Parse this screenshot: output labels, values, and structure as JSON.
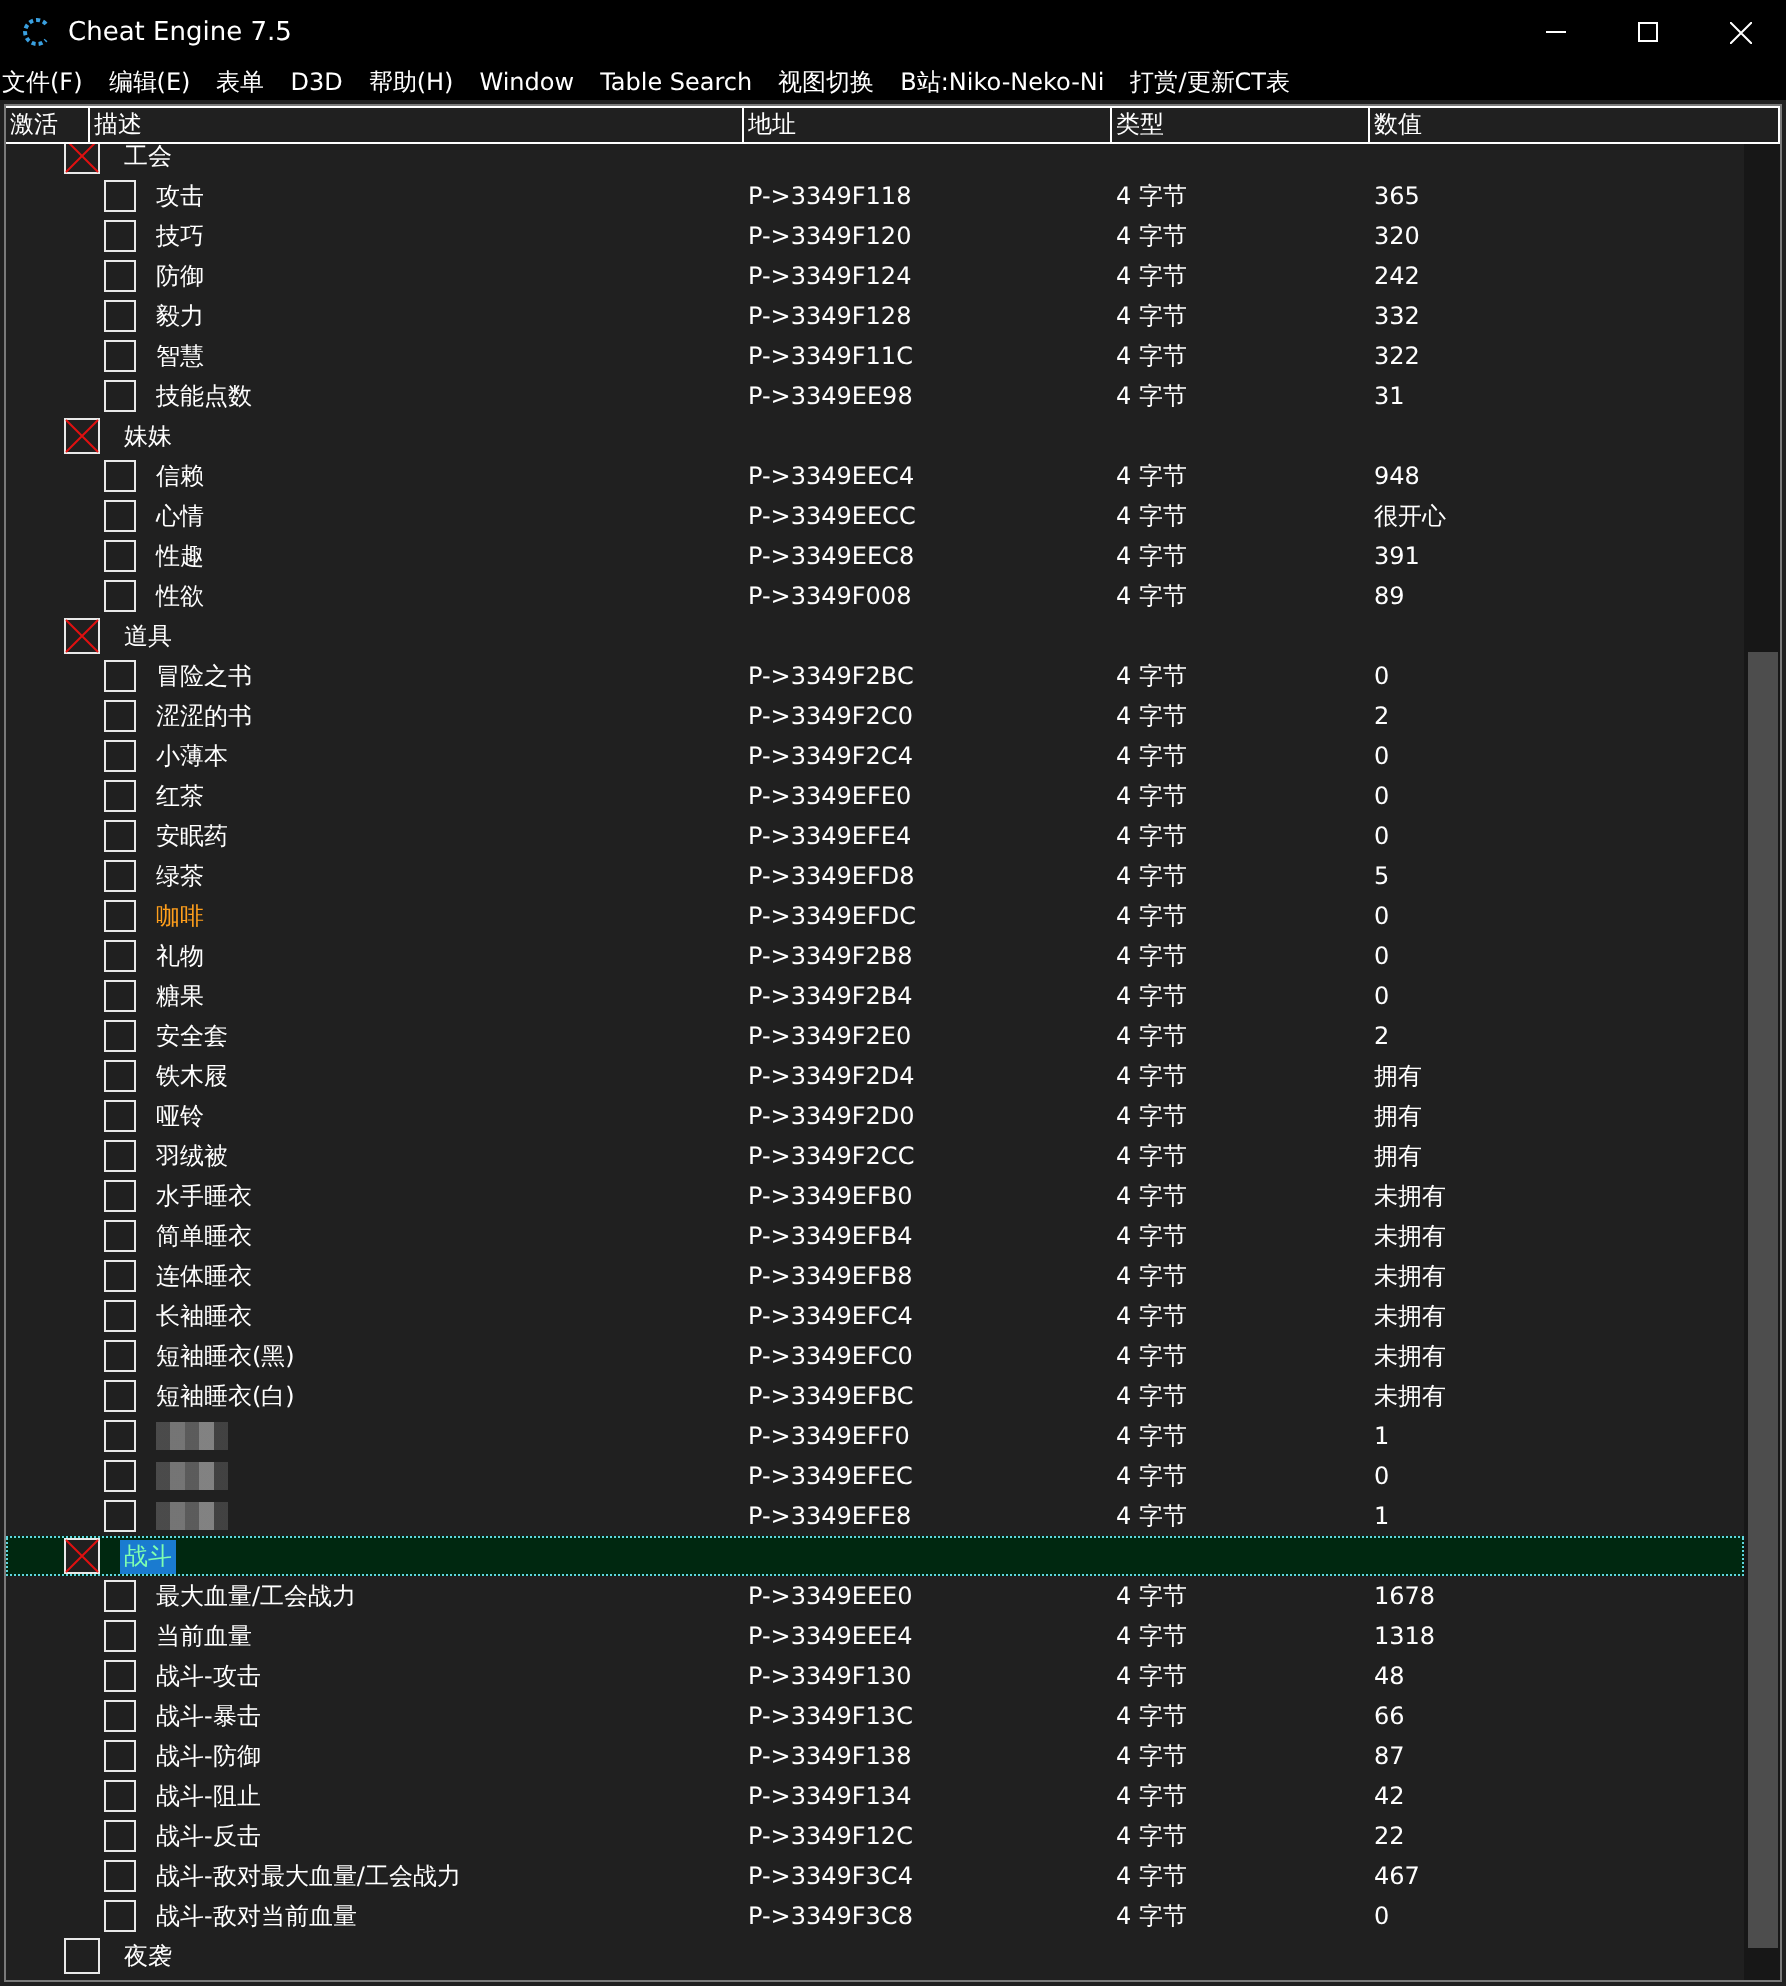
{
  "window": {
    "title": "Cheat Engine 7.5"
  },
  "menu": [
    "文件(F)",
    "编辑(E)",
    "表单",
    "D3D",
    "帮助(H)",
    "Window",
    "Table Search",
    "视图切换",
    "B站:Niko-Neko-Ni",
    "打赏/更新CT表"
  ],
  "table": {
    "columns": [
      "激活",
      "描述",
      "地址",
      "类型",
      "数值"
    ],
    "groups": [
      {
        "name": "工会",
        "crossed": true,
        "selected": false,
        "children": [
          {
            "kind": "entry",
            "checked": false,
            "description": "攻击",
            "address": "P->3349F118",
            "type": "4 字节",
            "value": "365"
          },
          {
            "kind": "entry",
            "checked": false,
            "description": "技巧",
            "address": "P->3349F120",
            "type": "4 字节",
            "value": "320"
          },
          {
            "kind": "entry",
            "checked": false,
            "description": "防御",
            "address": "P->3349F124",
            "type": "4 字节",
            "value": "242"
          },
          {
            "kind": "entry",
            "checked": false,
            "description": "毅力",
            "address": "P->3349F128",
            "type": "4 字节",
            "value": "332"
          },
          {
            "kind": "entry",
            "checked": false,
            "description": "智慧",
            "address": "P->3349F11C",
            "type": "4 字节",
            "value": "322"
          },
          {
            "kind": "entry",
            "checked": false,
            "description": "技能点数",
            "address": "P->3349EE98",
            "type": "4 字节",
            "value": "31"
          }
        ]
      },
      {
        "name": "妹妹",
        "crossed": true,
        "selected": false,
        "children": [
          {
            "kind": "entry",
            "checked": false,
            "description": "信赖",
            "address": "P->3349EEC4",
            "type": "4 字节",
            "value": "948"
          },
          {
            "kind": "entry",
            "checked": false,
            "description": "心情",
            "address": "P->3349EECC",
            "type": "4 字节",
            "value": "很开心"
          },
          {
            "kind": "entry",
            "checked": false,
            "description": "性趣",
            "address": "P->3349EEC8",
            "type": "4 字节",
            "value": "391"
          },
          {
            "kind": "entry",
            "checked": false,
            "description": "性欲",
            "address": "P->3349F008",
            "type": "4 字节",
            "value": "89"
          }
        ]
      },
      {
        "name": "道具",
        "crossed": true,
        "selected": false,
        "children": [
          {
            "kind": "entry",
            "checked": false,
            "description": "冒险之书",
            "address": "P->3349F2BC",
            "type": "4 字节",
            "value": "0"
          },
          {
            "kind": "entry",
            "checked": false,
            "description": "涩涩的书",
            "address": "P->3349F2C0",
            "type": "4 字节",
            "value": "2"
          },
          {
            "kind": "entry",
            "checked": false,
            "description": "小薄本",
            "address": "P->3349F2C4",
            "type": "4 字节",
            "value": "0"
          },
          {
            "kind": "entry",
            "checked": false,
            "description": "红茶",
            "address": "P->3349EFE0",
            "type": "4 字节",
            "value": "0"
          },
          {
            "kind": "entry",
            "checked": false,
            "description": "安眠药",
            "address": "P->3349EFE4",
            "type": "4 字节",
            "value": "0"
          },
          {
            "kind": "entry",
            "checked": false,
            "description": "绿茶",
            "address": "P->3349EFD8",
            "type": "4 字节",
            "value": "5"
          },
          {
            "kind": "entry",
            "checked": false,
            "description": "咖啡",
            "color": "#ff9f1c",
            "address": "P->3349EFDC",
            "type": "4 字节",
            "value": "0"
          },
          {
            "kind": "entry",
            "checked": false,
            "description": "礼物",
            "address": "P->3349F2B8",
            "type": "4 字节",
            "value": "0"
          },
          {
            "kind": "entry",
            "checked": false,
            "description": "糖果",
            "address": "P->3349F2B4",
            "type": "4 字节",
            "value": "0"
          },
          {
            "kind": "entry",
            "checked": false,
            "description": "安全套",
            "address": "P->3349F2E0",
            "type": "4 字节",
            "value": "2"
          },
          {
            "kind": "entry",
            "checked": false,
            "description": "铁木屐",
            "address": "P->3349F2D4",
            "type": "4 字节",
            "value": "拥有"
          },
          {
            "kind": "entry",
            "checked": false,
            "description": "哑铃",
            "address": "P->3349F2D0",
            "type": "4 字节",
            "value": "拥有"
          },
          {
            "kind": "entry",
            "checked": false,
            "description": "羽绒被",
            "address": "P->3349F2CC",
            "type": "4 字节",
            "value": "拥有"
          },
          {
            "kind": "entry",
            "checked": false,
            "description": "水手睡衣",
            "address": "P->3349EFB0",
            "type": "4 字节",
            "value": "未拥有"
          },
          {
            "kind": "entry",
            "checked": false,
            "description": "简单睡衣",
            "address": "P->3349EFB4",
            "type": "4 字节",
            "value": "未拥有"
          },
          {
            "kind": "entry",
            "checked": false,
            "description": "连体睡衣",
            "address": "P->3349EFB8",
            "type": "4 字节",
            "value": "未拥有"
          },
          {
            "kind": "entry",
            "checked": false,
            "description": "长袖睡衣",
            "address": "P->3349EFC4",
            "type": "4 字节",
            "value": "未拥有"
          },
          {
            "kind": "entry",
            "checked": false,
            "description": "短袖睡衣(黑)",
            "address": "P->3349EFC0",
            "type": "4 字节",
            "value": "未拥有"
          },
          {
            "kind": "entry",
            "checked": false,
            "description": "短袖睡衣(白)",
            "address": "P->3349EFBC",
            "type": "4 字节",
            "value": "未拥有"
          },
          {
            "kind": "blurred",
            "checked": false,
            "address": "P->3349EFF0",
            "type": "4 字节",
            "value": "1"
          },
          {
            "kind": "blurred",
            "checked": false,
            "address": "P->3349EFEC",
            "type": "4 字节",
            "value": "0"
          },
          {
            "kind": "blurred",
            "checked": false,
            "address": "P->3349EFE8",
            "type": "4 字节",
            "value": "1"
          }
        ]
      },
      {
        "name": "战斗",
        "crossed": true,
        "selected": true,
        "children": [
          {
            "kind": "entry",
            "checked": false,
            "description": "最大血量/工会战力",
            "address": "P->3349EEE0",
            "type": "4 字节",
            "value": "1678"
          },
          {
            "kind": "entry",
            "checked": false,
            "description": "当前血量",
            "address": "P->3349EEE4",
            "type": "4 字节",
            "value": "1318"
          },
          {
            "kind": "entry",
            "checked": false,
            "description": "战斗-攻击",
            "address": "P->3349F130",
            "type": "4 字节",
            "value": "48"
          },
          {
            "kind": "entry",
            "checked": false,
            "description": "战斗-暴击",
            "address": "P->3349F13C",
            "type": "4 字节",
            "value": "66"
          },
          {
            "kind": "entry",
            "checked": false,
            "description": "战斗-防御",
            "address": "P->3349F138",
            "type": "4 字节",
            "value": "87"
          },
          {
            "kind": "entry",
            "checked": false,
            "description": "战斗-阻止",
            "address": "P->3349F134",
            "type": "4 字节",
            "value": "42"
          },
          {
            "kind": "entry",
            "checked": false,
            "description": "战斗-反击",
            "address": "P->3349F12C",
            "type": "4 字节",
            "value": "22"
          },
          {
            "kind": "entry",
            "checked": false,
            "description": "战斗-敌对最大血量/工会战力",
            "address": "P->3349F3C4",
            "type": "4 字节",
            "value": "467"
          },
          {
            "kind": "entry",
            "checked": false,
            "description": "战斗-敌对当前血量",
            "address": "P->3349F3C8",
            "type": "4 字节",
            "value": "0"
          }
        ]
      },
      {
        "name": "夜袭",
        "crossed": false,
        "selected": false
      }
    ]
  }
}
